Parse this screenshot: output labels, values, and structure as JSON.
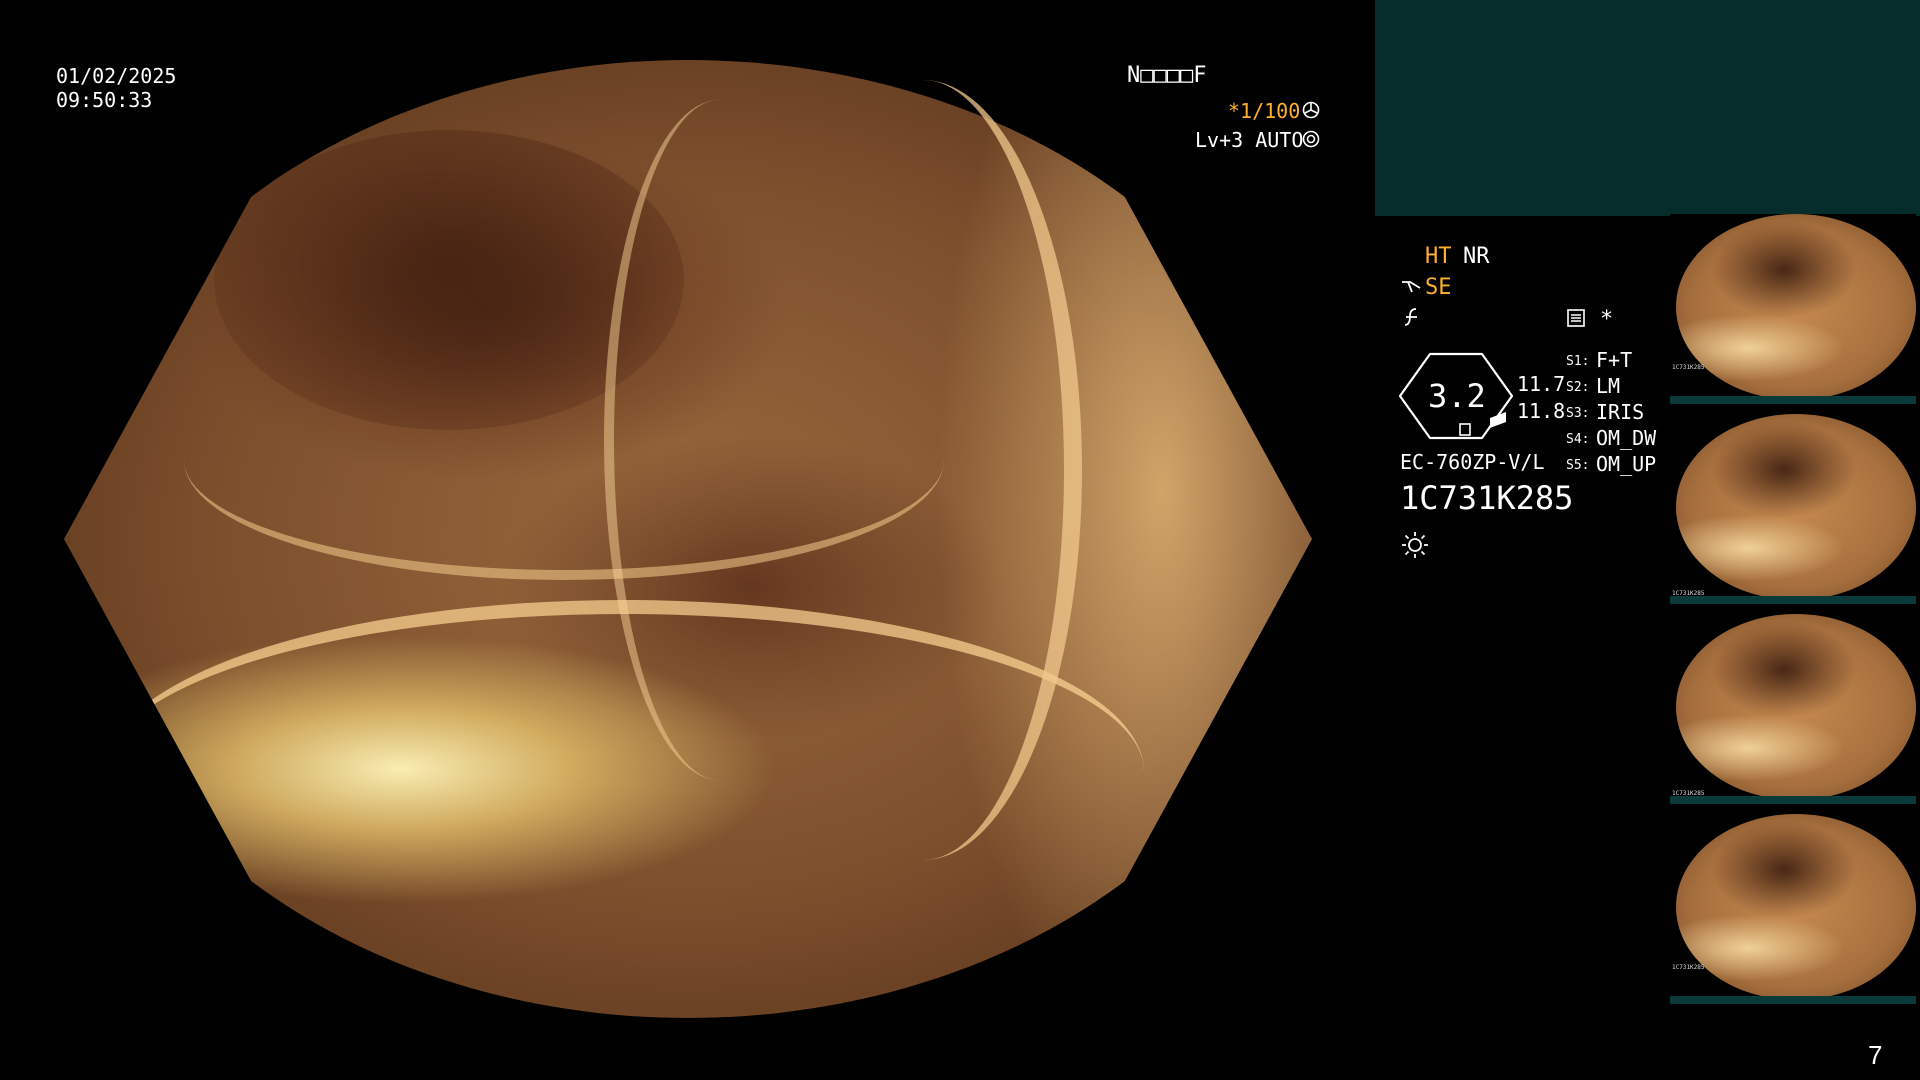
{
  "overlay": {
    "date": "01/02/2025",
    "time": "09:50:33",
    "patient_id": "N□□□□F",
    "shutter": "*1/100",
    "level": "Lv+3 AUTO"
  },
  "settings": {
    "ht": "HT",
    "nr": "NR",
    "se": "SE",
    "star": "*",
    "gauge_value": "3.2",
    "value_a": "11.7",
    "value_b": "11.8",
    "scope_model": "EC-760ZP-V/L",
    "serial": "1C731K285"
  },
  "switches": [
    {
      "key": "S1:",
      "value": "F+T"
    },
    {
      "key": "S2:",
      "value": "LM"
    },
    {
      "key": "S3:",
      "value": "IRIS"
    },
    {
      "key": "S4:",
      "value": "OM_DW"
    },
    {
      "key": "S5:",
      "value": "OM_UP"
    }
  ],
  "thumbnails": [
    {
      "serial": "1C731K285"
    },
    {
      "serial": "1C731K285"
    },
    {
      "serial": "1C731K285"
    },
    {
      "serial": "1C731K285"
    }
  ],
  "page_number": "7",
  "icons": [
    "shutter-icon",
    "auto-iris-icon",
    "scope-tip-icon",
    "function-icon",
    "memory-icon",
    "light-icon"
  ],
  "colors": {
    "accent": "#ffb02e",
    "panel": "#062c2c",
    "text": "#ffffff"
  }
}
